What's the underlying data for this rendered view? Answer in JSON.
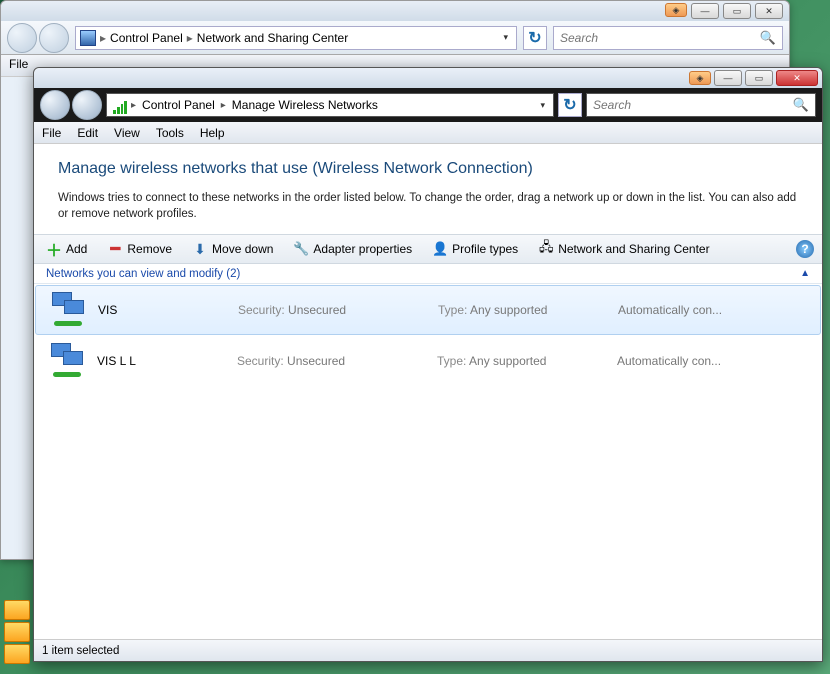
{
  "bg": {
    "crumb1": "Control Panel",
    "crumb2": "Network and Sharing Center",
    "search_placeholder": "Search",
    "menu_file": "File"
  },
  "breadcrumb": {
    "crumb1": "Control Panel",
    "crumb2": "Manage Wireless Networks"
  },
  "search": {
    "placeholder": "Search"
  },
  "menu": {
    "file": "File",
    "edit": "Edit",
    "view": "View",
    "tools": "Tools",
    "help": "Help"
  },
  "header": {
    "title": "Manage wireless networks that use (Wireless Network Connection)",
    "desc": "Windows tries to connect to these networks in the order listed below. To change the order, drag a network up or down in the list. You can also add or remove network profiles."
  },
  "toolbar": {
    "add": "Add",
    "remove": "Remove",
    "movedown": "Move down",
    "adapter": "Adapter properties",
    "profile": "Profile types",
    "sharing": "Network and Sharing Center"
  },
  "group": {
    "label": "Networks you can view and modify (2)"
  },
  "labels": {
    "security": "Security:",
    "type": "Type:"
  },
  "networks": [
    {
      "name": "VIS",
      "security": "Unsecured",
      "type": "Any supported",
      "auto": "Automatically con..."
    },
    {
      "name": "VIS L L",
      "security": "Unsecured",
      "type": "Any supported",
      "auto": "Automatically con..."
    }
  ],
  "status": "1 item selected"
}
